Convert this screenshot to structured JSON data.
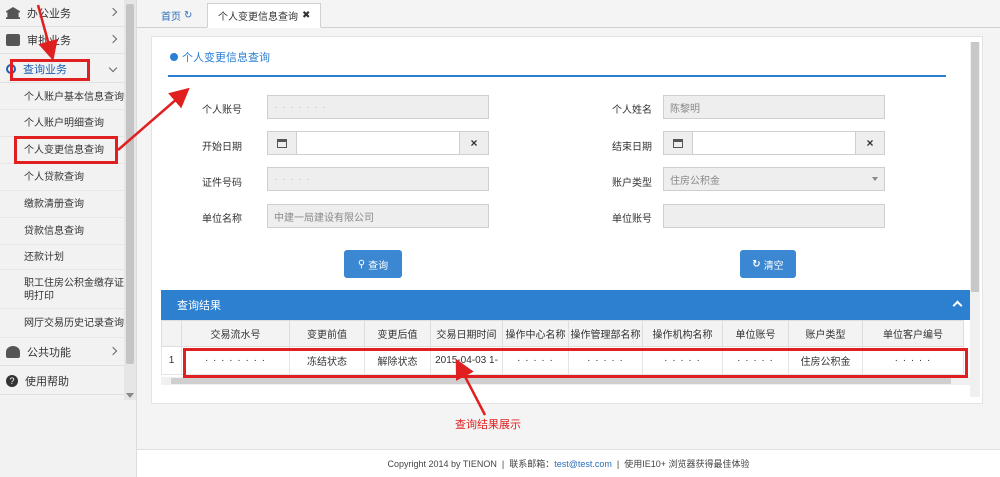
{
  "sidebar": {
    "menus": [
      {
        "label": "办公业务",
        "icon": "bank-icon"
      },
      {
        "label": "审批业务",
        "icon": "briefcase-icon"
      },
      {
        "label": "查询业务",
        "icon": "search-icon"
      }
    ],
    "sub_items": [
      "个人账户基本信息查询",
      "个人账户明细查询",
      "个人变更信息查询",
      "个人贷款查询",
      "缴款清册查询",
      "贷款信息查询",
      "还款计划",
      "职工住房公积金缴存证明打印",
      "网厅交易历史记录查询"
    ],
    "bottom_menus": [
      {
        "label": "公共功能",
        "icon": "users-icon"
      },
      {
        "label": "使用帮助",
        "icon": "help-icon"
      }
    ]
  },
  "tabs": [
    {
      "label": "首页",
      "icon": "refresh-icon"
    },
    {
      "label": "个人变更信息查询",
      "icon": "close-icon"
    }
  ],
  "panel": {
    "title": "个人变更信息查询"
  },
  "form": {
    "account_label": "个人账号",
    "account_value": "· · · · · · ·",
    "name_label": "个人姓名",
    "name_value": "陈黎明",
    "start_label": "开始日期",
    "end_label": "结束日期",
    "id_label": "证件号码",
    "id_value": "· · · · ·",
    "acct_type_label": "账户类型",
    "acct_type_value": "住房公积金",
    "unit_name_label": "单位名称",
    "unit_name_value": "中建一局建设有限公司",
    "unit_acct_label": "单位账号",
    "unit_acct_value": ""
  },
  "buttons": {
    "query": "查询",
    "clear": "清空"
  },
  "result": {
    "title": "查询结果",
    "columns": [
      "",
      "交易流水号",
      "变更前值",
      "变更后值",
      "交易日期时间",
      "操作中心名称",
      "操作管理部名称",
      "操作机构名称",
      "单位账号",
      "账户类型",
      "单位客户编号"
    ],
    "rows": [
      [
        "1",
        "· · · · · · · ·",
        "冻结状态",
        "解除状态",
        "2015-04-03 1-",
        "· · · · ·",
        "· · · · ·",
        "· · · · ·",
        "· · · · ·",
        "住房公积金",
        "· · · · ·"
      ]
    ]
  },
  "annotation": {
    "result_label": "查询结果展示"
  },
  "footer": {
    "copyright": "Copyright 2014 by TIENON",
    "separator": "|",
    "email_label": "联系邮箱：",
    "email": "test@test.com",
    "browser_note": "使用IE10+ 浏览器获得最佳体验"
  }
}
